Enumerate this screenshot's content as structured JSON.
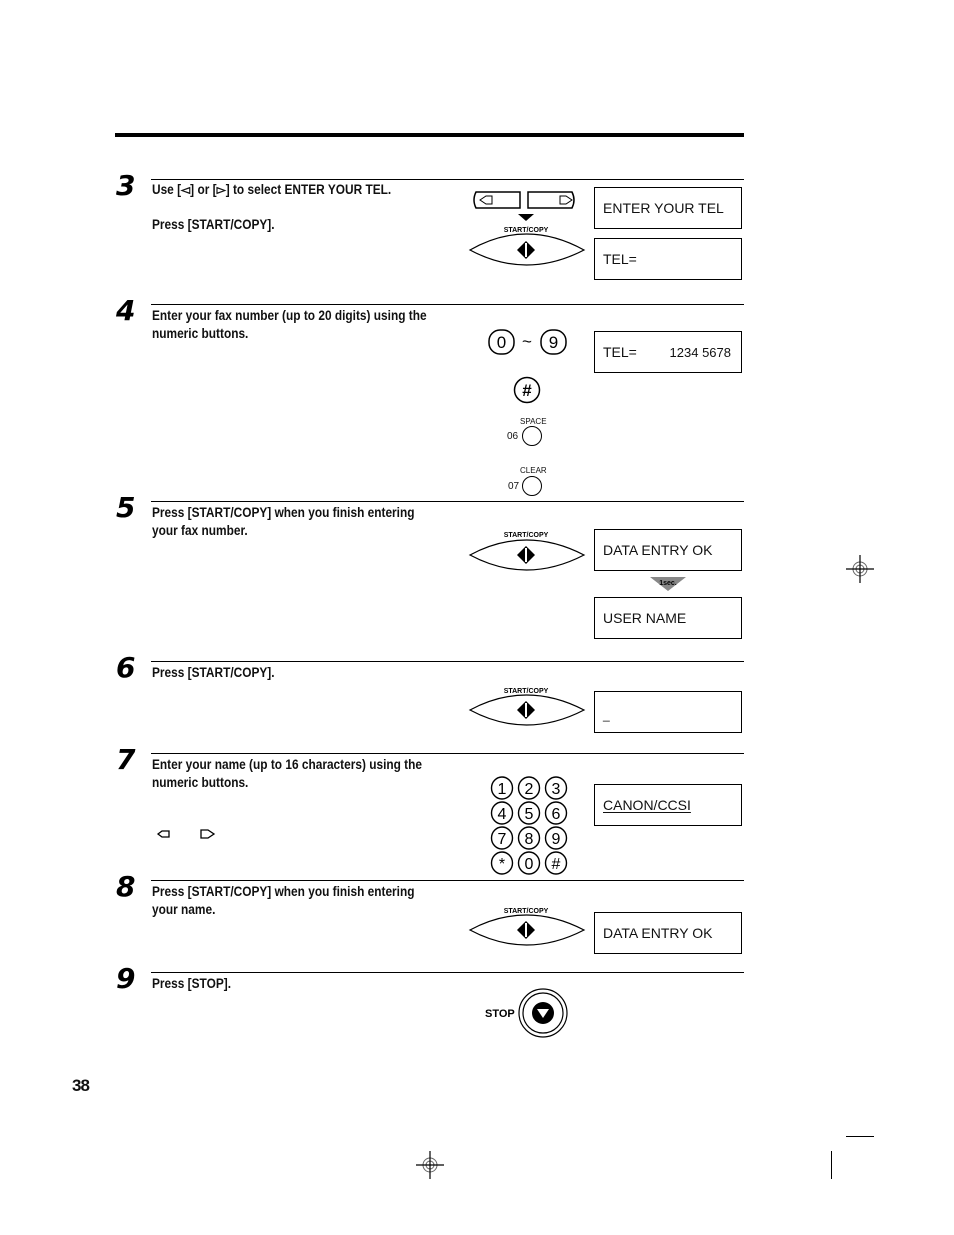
{
  "page": {
    "number": "38"
  },
  "steps": [
    {
      "number": "3",
      "lines": [
        "Use [◅] or [▻] to select ENTER YOUR TEL.",
        "",
        "Press [START/COPY]."
      ],
      "displays": [
        {
          "text": "ENTER YOUR TEL",
          "value": ""
        },
        {
          "text": "TEL=",
          "value": ""
        }
      ],
      "button_label": "START/COPY"
    },
    {
      "number": "4",
      "lines": [
        "Enter your fax number (up to 20 digits) using the",
        "numeric buttons."
      ],
      "displays": [
        {
          "text": "TEL=",
          "value": "1234 5678"
        }
      ],
      "keys": {
        "range_from": "0",
        "range_to": "9",
        "range_sep": "~",
        "hash": "#",
        "space_label": "SPACE",
        "space_code": "06",
        "clear_label": "CLEAR",
        "clear_code": "07"
      }
    },
    {
      "number": "5",
      "lines": [
        "Press [START/COPY] when you finish entering",
        "your fax number."
      ],
      "displays": [
        {
          "text": "DATA ENTRY OK",
          "value": ""
        },
        {
          "text": "USER NAME",
          "value": ""
        }
      ],
      "arrow_label": "1sec."
    },
    {
      "number": "6",
      "lines": [
        "Press [START/COPY]."
      ],
      "displays": [
        {
          "text": "_",
          "value": ""
        }
      ]
    },
    {
      "number": "7",
      "lines": [
        "Enter your name (up to 16 characters) using the",
        "numeric buttons."
      ],
      "displays": [
        {
          "text": "CANON/CCSI",
          "value": ""
        }
      ],
      "keypad": [
        "1",
        "2",
        "3",
        "4",
        "5",
        "6",
        "7",
        "8",
        "9",
        "*",
        "0",
        "#"
      ]
    },
    {
      "number": "8",
      "lines": [
        "Press [START/COPY] when you finish entering",
        "your name."
      ],
      "displays": [
        {
          "text": "DATA ENTRY OK",
          "value": ""
        }
      ]
    },
    {
      "number": "9",
      "lines": [
        "Press [STOP]."
      ],
      "stop_label": "STOP"
    }
  ]
}
